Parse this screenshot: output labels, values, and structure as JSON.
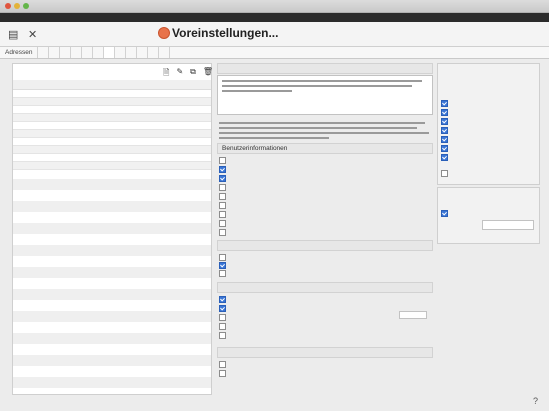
{
  "window": {
    "title": ""
  },
  "menu": {
    "left": "",
    "right": ""
  },
  "toolbar": {
    "page_title": "Voreinstellungen..."
  },
  "tabs": [
    {
      "label": "Adressen"
    },
    {
      "label": ""
    },
    {
      "label": ""
    },
    {
      "label": ""
    },
    {
      "label": ""
    },
    {
      "label": ""
    },
    {
      "label": ""
    },
    {
      "label": ""
    },
    {
      "label": ""
    },
    {
      "label": ""
    },
    {
      "label": ""
    },
    {
      "label": ""
    },
    {
      "label": ""
    }
  ],
  "left_panel": {
    "title": "",
    "columns": [
      "",
      ""
    ],
    "rows": [
      {
        "a": "",
        "b": ""
      },
      {
        "a": "",
        "b": ""
      },
      {
        "a": "",
        "b": ""
      },
      {
        "a": "",
        "b": ""
      },
      {
        "a": "",
        "b": ""
      },
      {
        "a": "",
        "b": ""
      },
      {
        "a": "",
        "b": ""
      },
      {
        "a": "",
        "b": ""
      },
      {
        "a": "",
        "b": ""
      },
      {
        "a": "",
        "b": ""
      }
    ]
  },
  "middle": {
    "section1_title": "",
    "section2_title": "Benutzerinformationen",
    "options_a": [
      {
        "label": "",
        "checked": false
      },
      {
        "label": "",
        "checked": true
      },
      {
        "label": "",
        "checked": true
      },
      {
        "label": "",
        "checked": false
      },
      {
        "label": "",
        "checked": false
      },
      {
        "label": "",
        "checked": false
      },
      {
        "label": "",
        "checked": false
      },
      {
        "label": "",
        "checked": false
      },
      {
        "label": "",
        "checked": false
      }
    ],
    "section3_title": "",
    "options_b": [
      {
        "label": "",
        "checked": false
      },
      {
        "label": "",
        "checked": true
      },
      {
        "label": "",
        "checked": false
      }
    ],
    "section4_title": "",
    "options_c": [
      {
        "label": "",
        "checked": true
      },
      {
        "label": "",
        "checked": true
      },
      {
        "label": "",
        "checked": false
      },
      {
        "label": "",
        "checked": false
      },
      {
        "label": "",
        "checked": false
      }
    ],
    "section5_title": "",
    "options_d": [
      {
        "label": "",
        "checked": false
      },
      {
        "label": "",
        "checked": false
      }
    ]
  },
  "right": {
    "panel1_title": "",
    "panel1_desc": "",
    "panel1_items": [
      {
        "label": "",
        "checked": true
      },
      {
        "label": "",
        "checked": true
      },
      {
        "label": "",
        "checked": true
      },
      {
        "label": "",
        "checked": true
      },
      {
        "label": "",
        "checked": true
      },
      {
        "label": "",
        "checked": true
      },
      {
        "label": "",
        "checked": true
      }
    ],
    "panel1_bottom": "",
    "panel2_title": "",
    "panel2_cb": "",
    "panel2_field_label": "",
    "panel2_field_value": ""
  }
}
